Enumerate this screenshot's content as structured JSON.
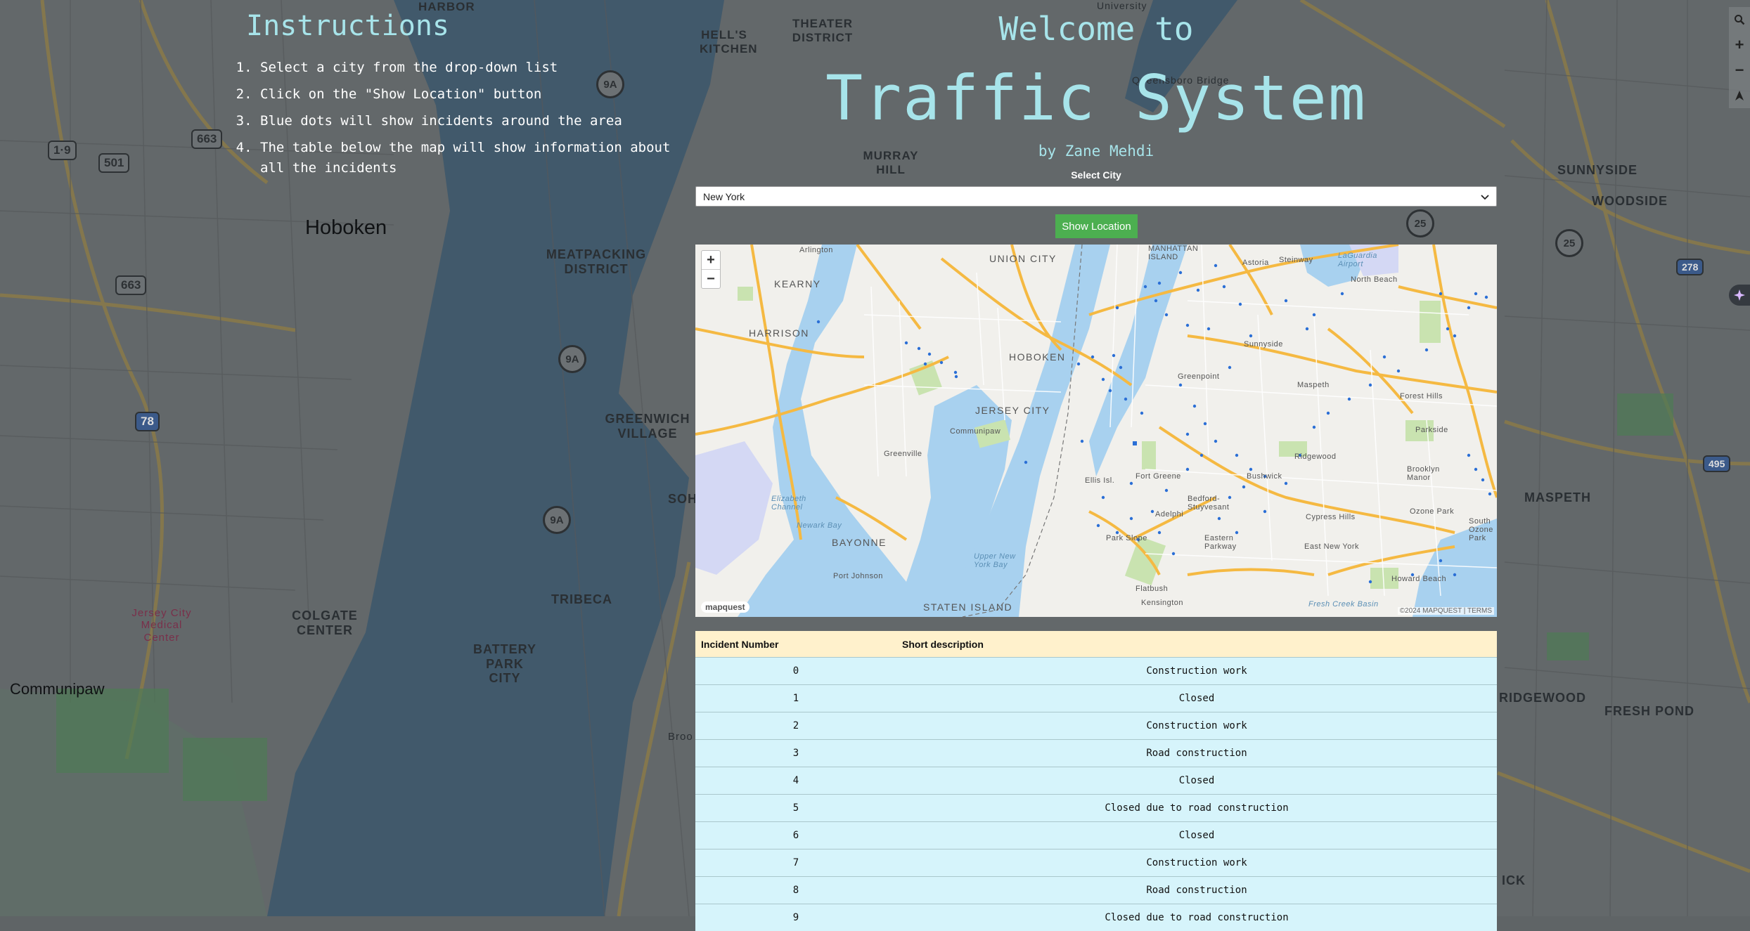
{
  "background_map": {
    "labels": [
      "HARBOR",
      "HELL'S KITCHEN",
      "THEATER DISTRICT",
      "University",
      "Queensboro Bridge",
      "MURRAY HILL",
      "SUNNYSIDE",
      "WOODSIDE",
      "Hoboken",
      "MEATPACKING DISTRICT",
      "GREENWICH VILLAGE",
      "SOH",
      "TRIBECA",
      "COLGATE CENTER",
      "BATTERY PARK CITY",
      "Jersey City Medical Center",
      "Communipaw",
      "Broo",
      "MASPETH",
      "RIDGEWOOD",
      "FRESH POND",
      "ICK"
    ],
    "shields": [
      "1·9",
      "501",
      "663",
      "663",
      "78",
      "9A",
      "9A",
      "9A",
      "25",
      "25",
      "278",
      "495"
    ]
  },
  "side_controls": {
    "icons": [
      "search-icon",
      "zoom-in-icon",
      "zoom-out-icon",
      "compass-icon"
    ],
    "zoom_in": "+",
    "zoom_out": "−",
    "ai_icon": "sparkle-icon"
  },
  "instructions": {
    "title": "Instructions",
    "steps": [
      "Select a city from the drop-down list",
      "Click on the \"Show Location\" button",
      "Blue dots will show incidents around the area",
      "The table below the map will show information about all the incidents"
    ]
  },
  "header": {
    "welcome": "Welcome to",
    "title": "Traffic System",
    "byline": "by Zane Mehdi"
  },
  "city_select": {
    "label": "Select City",
    "value": "New York"
  },
  "show_button": "Show Location",
  "map": {
    "zoom_in": "+",
    "zoom_out": "−",
    "logo": "mapquest",
    "attribution": "©2024 MAPQUEST  |  TERMS",
    "labels": [
      "Arlington",
      "KEARNY",
      "UNION CITY",
      "HARRISON",
      "HOBOKEN",
      "JERSEY CITY",
      "Communipaw",
      "Greenville",
      "Elizabeth Channel",
      "Newark Bay",
      "BAYONNE",
      "Port Johnson",
      "STATEN ISLAND",
      "Upper New York Bay",
      "MANHATTAN ISLAND",
      "Astoria",
      "Steinway",
      "LaGuardia Airport",
      "North Beach",
      "Sunnyside",
      "Greenpoint",
      "Maspeth",
      "Forest Hills",
      "Parkside",
      "Ridgewood",
      "Fort Greene",
      "Bushwick",
      "Bedford-Stuyvesant",
      "Brooklyn Manor",
      "Adelphi",
      "Ozone Park",
      "Park Slope",
      "Eastern Parkway",
      "Cypress Hills",
      "East New York",
      "South Ozone Park",
      "Flatbush",
      "Kensington",
      "Howard Beach",
      "Fresh Creek Basin",
      "Ellis Isl."
    ],
    "incident_dot_color": "#2b6fd6"
  },
  "table": {
    "headers": [
      "Incident Number",
      "Short description"
    ],
    "rows": [
      [
        "0",
        "Construction work"
      ],
      [
        "1",
        "Closed"
      ],
      [
        "2",
        "Construction work"
      ],
      [
        "3",
        "Road construction"
      ],
      [
        "4",
        "Closed"
      ],
      [
        "5",
        "Closed due to road construction"
      ],
      [
        "6",
        "Closed"
      ],
      [
        "7",
        "Construction work"
      ],
      [
        "8",
        "Road construction"
      ],
      [
        "9",
        "Closed due to road construction"
      ]
    ]
  }
}
